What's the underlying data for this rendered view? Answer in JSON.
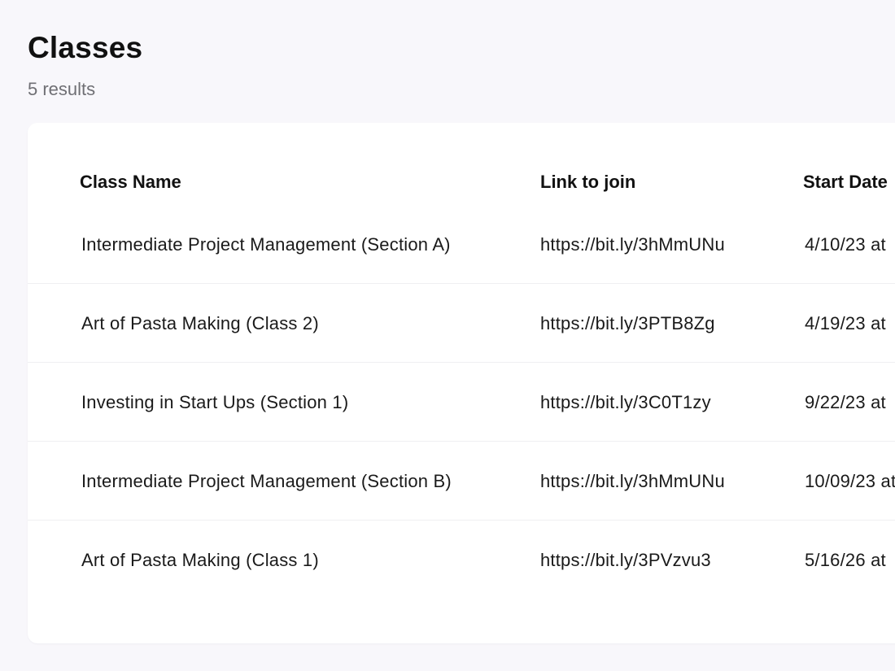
{
  "page": {
    "title": "Classes",
    "result_count": "5 results"
  },
  "table": {
    "columns": [
      "Class Name",
      "Link to join",
      "Start Date"
    ],
    "rows": [
      {
        "class_name": "Intermediate Project Management (Section A)",
        "link": "https://bit.ly/3hMmUNu",
        "start_date": "4/10/23 at"
      },
      {
        "class_name": "Art of Pasta Making (Class 2)",
        "link": "https://bit.ly/3PTB8Zg",
        "start_date": "4/19/23 at"
      },
      {
        "class_name": "Investing in Start Ups (Section 1)",
        "link": "https://bit.ly/3C0T1zy",
        "start_date": "9/22/23 at"
      },
      {
        "class_name": "Intermediate Project Management (Section B)",
        "link": "https://bit.ly/3hMmUNu",
        "start_date": "10/09/23 at"
      },
      {
        "class_name": "Art of Pasta Making (Class 1)",
        "link": "https://bit.ly/3PVzvu3",
        "start_date": "5/16/26 at"
      }
    ]
  },
  "colors": {
    "background": "#f8f7fb",
    "card": "#ffffff",
    "text": "#111111",
    "muted": "#6f6f74",
    "divider": "#efeff2"
  }
}
